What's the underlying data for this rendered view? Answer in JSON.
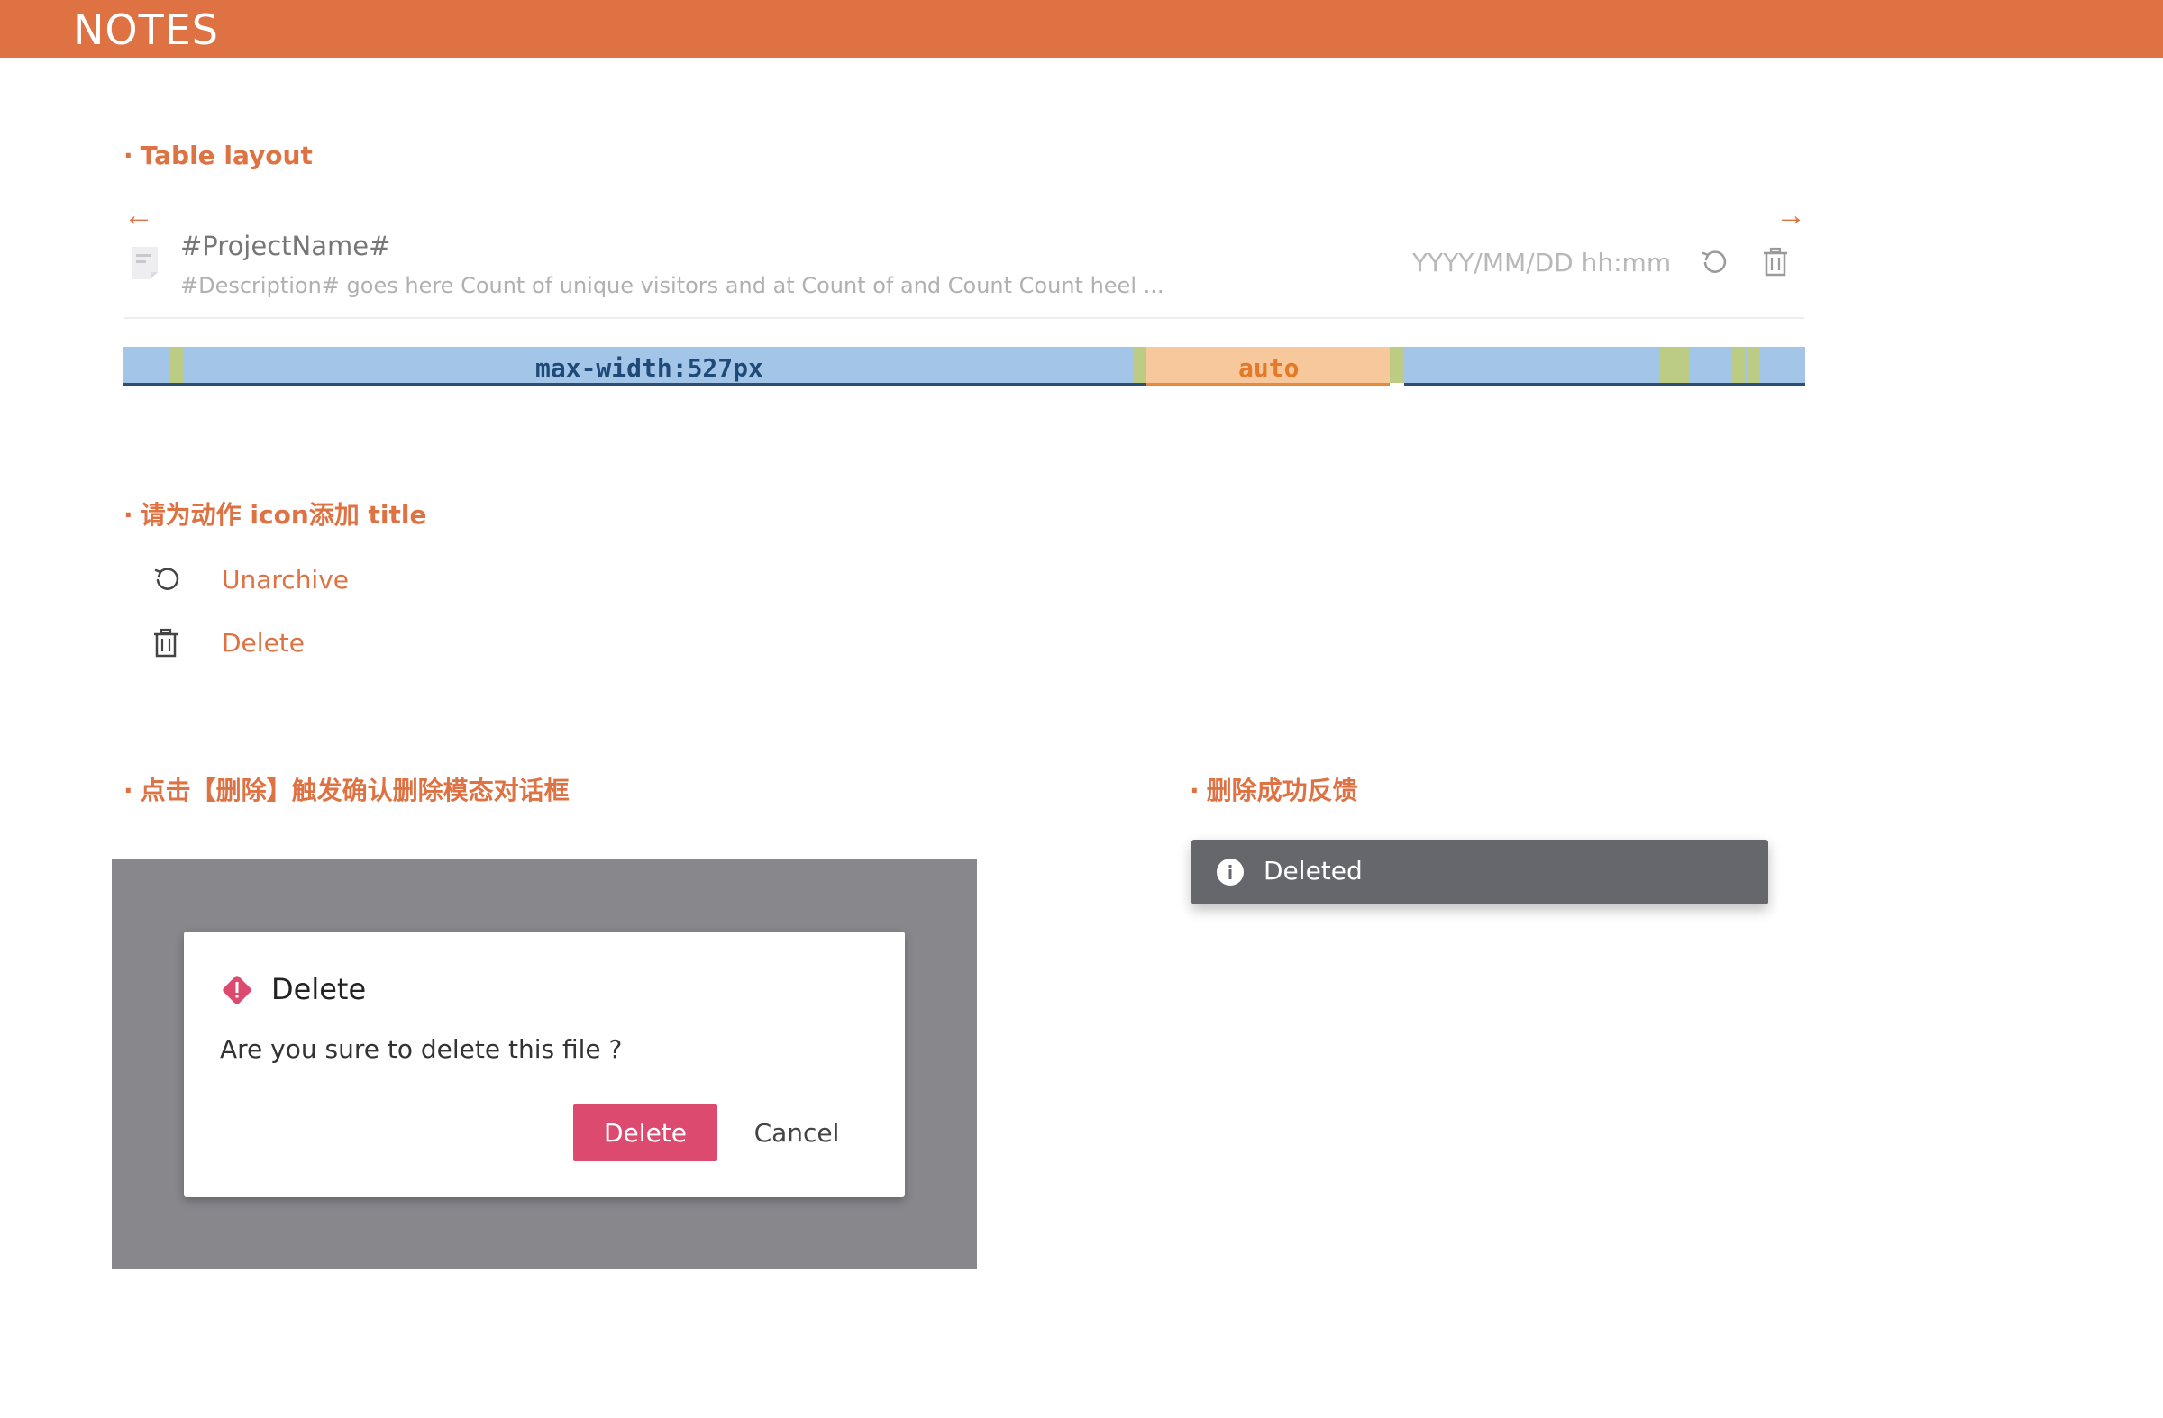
{
  "header": {
    "title": "NOTES"
  },
  "sections": {
    "table_layout": {
      "dot": "·",
      "title": "Table layout"
    },
    "action_icons": {
      "dot": "·",
      "title": "请为动作 icon添加 title"
    },
    "delete_modal": {
      "dot": "·",
      "title": "点击【删除】触发确认删除模态对话框"
    },
    "delete_feedback": {
      "dot": "·",
      "title": "删除成功反馈"
    }
  },
  "table_row": {
    "left_arrow": "←",
    "right_arrow": "→",
    "project_name": "#ProjectName#",
    "description": "#Description# goes here Count of unique visitors and at Count of and Count Count heel ...",
    "date_placeholder": "YYYY/MM/DD hh:mm",
    "icons": [
      "document-icon",
      "unarchive-icon",
      "delete-icon"
    ]
  },
  "layout_bar": {
    "label_main": "max-width:527px",
    "label_auto": "auto",
    "colors": {
      "blue": "#a3c6e8",
      "green": "#bccc85",
      "orange": "#f7c89b"
    }
  },
  "actions": [
    {
      "icon": "unarchive-icon",
      "label": "Unarchive"
    },
    {
      "icon": "trash-icon",
      "label": "Delete"
    }
  ],
  "modal": {
    "title": "Delete",
    "message": "Are you sure to delete this file ?",
    "confirm_label": "Delete",
    "cancel_label": "Cancel",
    "icon": "warning-diamond-icon"
  },
  "toast": {
    "icon": "info-icon",
    "message": "Deleted"
  },
  "colors": {
    "accent": "#de7243",
    "danger": "#dc4b6f",
    "toast_bg": "#66666d",
    "backdrop": "#88878c"
  }
}
